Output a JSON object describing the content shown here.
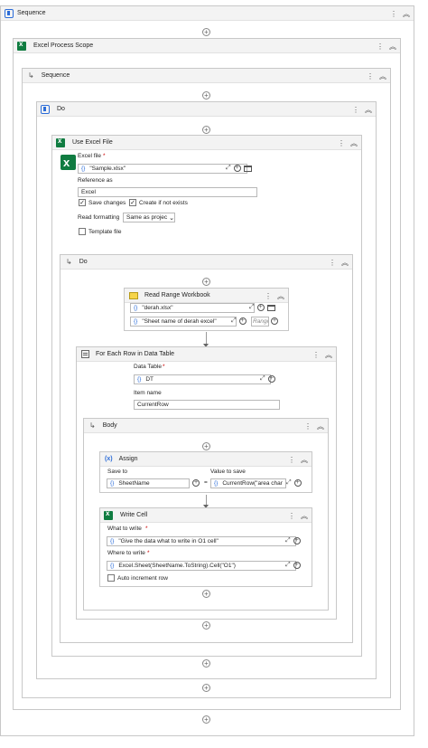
{
  "sequence": {
    "title": "Sequence"
  },
  "excel_process_scope": {
    "title": "Excel Process Scope"
  },
  "inner_sequence": {
    "title": "Sequence"
  },
  "do1": {
    "title": "Do"
  },
  "use_excel_file": {
    "title": "Use Excel File",
    "excel_file_label": "Excel file",
    "required_mark": "*",
    "excel_file_value": "\"Sample.xlsx\"",
    "reference_label": "Reference as",
    "reference_value": "Excel",
    "save_changes": "Save changes",
    "create_if_not_exists": "Create if not exists",
    "read_formatting_label": "Read formatting",
    "read_formatting_value": "Same as project",
    "template_file": "Template file"
  },
  "do2": {
    "title": "Do"
  },
  "read_range": {
    "title": "Read Range Workbook",
    "file_value": "\"derah.xlsx\"",
    "sheet_value": "\"Sheet name of derah excel\"",
    "range_placeholder": "Range"
  },
  "for_each": {
    "title": "For Each Row in Data Table",
    "data_table_label": "Data Table",
    "required_mark": "*",
    "data_table_value": "DT",
    "item_name_label": "Item name",
    "item_name_value": "CurrentRow"
  },
  "body": {
    "title": "Body"
  },
  "assign": {
    "title": "Assign",
    "save_to_label": "Save to",
    "value_label": "Value to save",
    "save_to_value": "SheetName",
    "value_value": "CurrentRow(\"area char",
    "equals": "="
  },
  "write_cell": {
    "title": "Write Cell",
    "what_label": "What to write",
    "required_mark": "*",
    "what_value": "\"Give the data what to write in O1 cell\"",
    "where_label": "Where to write",
    "where_value": "Excel.Sheet(SheetName.ToString).Cell(\"O1\")",
    "auto_increment": "Auto increment row"
  },
  "icons": {
    "curly": "{}",
    "expand": "⤢",
    "plus": "+",
    "kebab": "⋮",
    "collapse": "︽",
    "check": "✓",
    "dropdown": "⌄",
    "branch": "↳"
  }
}
